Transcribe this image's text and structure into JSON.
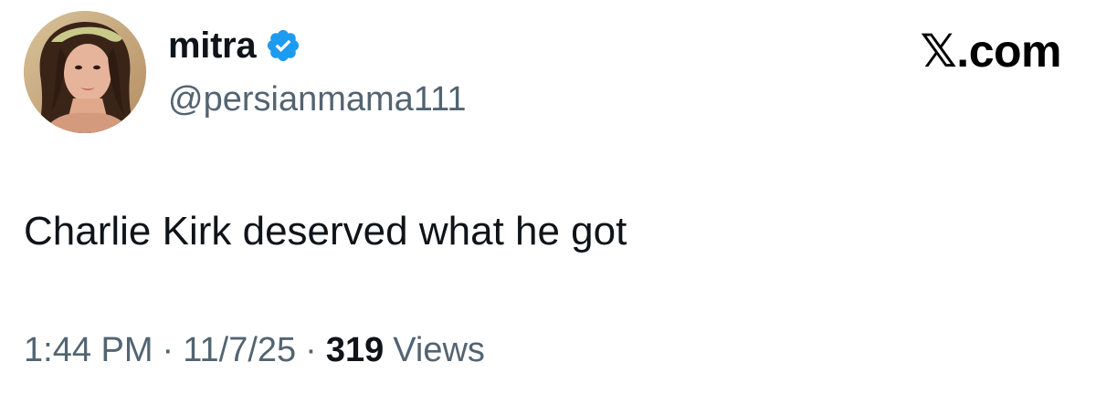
{
  "author": {
    "display_name": "mitra",
    "handle": "@persianmama111",
    "verified": true,
    "avatar": "profile-photo"
  },
  "brand": {
    "label": "𝕏.com"
  },
  "tweet": {
    "text": "Charlie Kirk deserved what he got"
  },
  "meta": {
    "time": "1:44 PM",
    "separator": "·",
    "date": "11/7/25",
    "views_count": "319",
    "views_label": "Views"
  },
  "colors": {
    "text_primary": "#0f1419",
    "text_secondary": "#536471",
    "verified_blue": "#1d9bf0",
    "background": "#ffffff"
  }
}
